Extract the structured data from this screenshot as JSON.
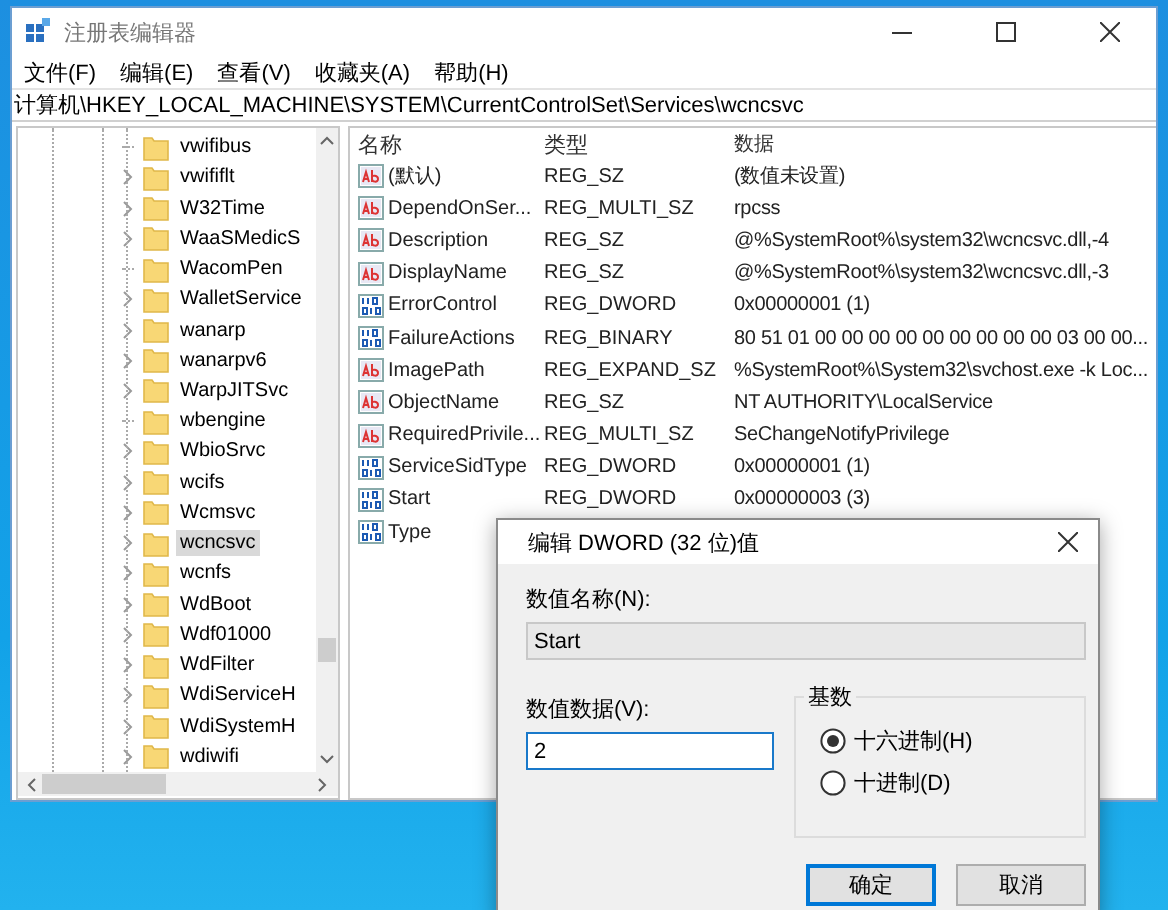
{
  "window": {
    "title": "注册表编辑器"
  },
  "menu": [
    "文件(F)",
    "编辑(E)",
    "查看(V)",
    "收藏夹(A)",
    "帮助(H)"
  ],
  "address": "计算机\\HKEY_LOCAL_MACHINE\\SYSTEM\\CurrentControlSet\\Services\\wcncsvc",
  "tree": {
    "items": [
      {
        "label": "vwifibus",
        "expandable": false,
        "selected": false
      },
      {
        "label": "vwififlt",
        "expandable": true,
        "selected": false
      },
      {
        "label": "W32Time",
        "expandable": true,
        "selected": false
      },
      {
        "label": "WaaSMedicS",
        "expandable": true,
        "selected": false
      },
      {
        "label": "WacomPen",
        "expandable": false,
        "selected": false
      },
      {
        "label": "WalletService",
        "expandable": true,
        "selected": false
      },
      {
        "label": "wanarp",
        "expandable": true,
        "selected": false
      },
      {
        "label": "wanarpv6",
        "expandable": true,
        "selected": false
      },
      {
        "label": "WarpJITSvc",
        "expandable": true,
        "selected": false
      },
      {
        "label": "wbengine",
        "expandable": false,
        "selected": false
      },
      {
        "label": "WbioSrvc",
        "expandable": true,
        "selected": false
      },
      {
        "label": "wcifs",
        "expandable": true,
        "selected": false
      },
      {
        "label": "Wcmsvc",
        "expandable": true,
        "selected": false
      },
      {
        "label": "wcncsvc",
        "expandable": true,
        "selected": true
      },
      {
        "label": "wcnfs",
        "expandable": true,
        "selected": false
      },
      {
        "label": "WdBoot",
        "expandable": true,
        "selected": false
      },
      {
        "label": "Wdf01000",
        "expandable": true,
        "selected": false
      },
      {
        "label": "WdFilter",
        "expandable": true,
        "selected": false
      },
      {
        "label": "WdiServiceH",
        "expandable": true,
        "selected": false
      },
      {
        "label": "WdiSystemH",
        "expandable": true,
        "selected": false
      },
      {
        "label": "wdiwifi",
        "expandable": true,
        "selected": false
      }
    ]
  },
  "values": {
    "columns": [
      "名称",
      "类型",
      "数据"
    ],
    "rows": [
      {
        "kind": "string",
        "name": "(默认)",
        "type": "REG_SZ",
        "data": "(数值未设置)"
      },
      {
        "kind": "string",
        "name": "DependOnSer...",
        "type": "REG_MULTI_SZ",
        "data": "rpcss"
      },
      {
        "kind": "string",
        "name": "Description",
        "type": "REG_SZ",
        "data": "@%SystemRoot%\\system32\\wcncsvc.dll,-4"
      },
      {
        "kind": "string",
        "name": "DisplayName",
        "type": "REG_SZ",
        "data": "@%SystemRoot%\\system32\\wcncsvc.dll,-3"
      },
      {
        "kind": "binary",
        "name": "ErrorControl",
        "type": "REG_DWORD",
        "data": "0x00000001 (1)"
      },
      {
        "kind": "binary",
        "name": "FailureActions",
        "type": "REG_BINARY",
        "data": "80 51 01 00 00 00 00 00 00 00 00 00 03 00 00..."
      },
      {
        "kind": "string",
        "name": "ImagePath",
        "type": "REG_EXPAND_SZ",
        "data": "%SystemRoot%\\System32\\svchost.exe -k Loc..."
      },
      {
        "kind": "string",
        "name": "ObjectName",
        "type": "REG_SZ",
        "data": "NT AUTHORITY\\LocalService"
      },
      {
        "kind": "string",
        "name": "RequiredPrivile...",
        "type": "REG_MULTI_SZ",
        "data": "SeChangeNotifyPrivilege"
      },
      {
        "kind": "binary",
        "name": "ServiceSidType",
        "type": "REG_DWORD",
        "data": "0x00000001 (1)"
      },
      {
        "kind": "binary",
        "name": "Start",
        "type": "REG_DWORD",
        "data": "0x00000003 (3)"
      },
      {
        "kind": "binary",
        "name": "Type"
      }
    ]
  },
  "dialog": {
    "title": "编辑 DWORD (32 位)值",
    "name_label": "数值名称(N):",
    "name_value": "Start",
    "data_label": "数值数据(V):",
    "data_value": "2",
    "base": {
      "title": "基数",
      "options": [
        {
          "label": "十六进制(H)",
          "selected": true
        },
        {
          "label": "十进制(D)",
          "selected": false
        }
      ]
    },
    "buttons": [
      "确定",
      "取消"
    ]
  }
}
